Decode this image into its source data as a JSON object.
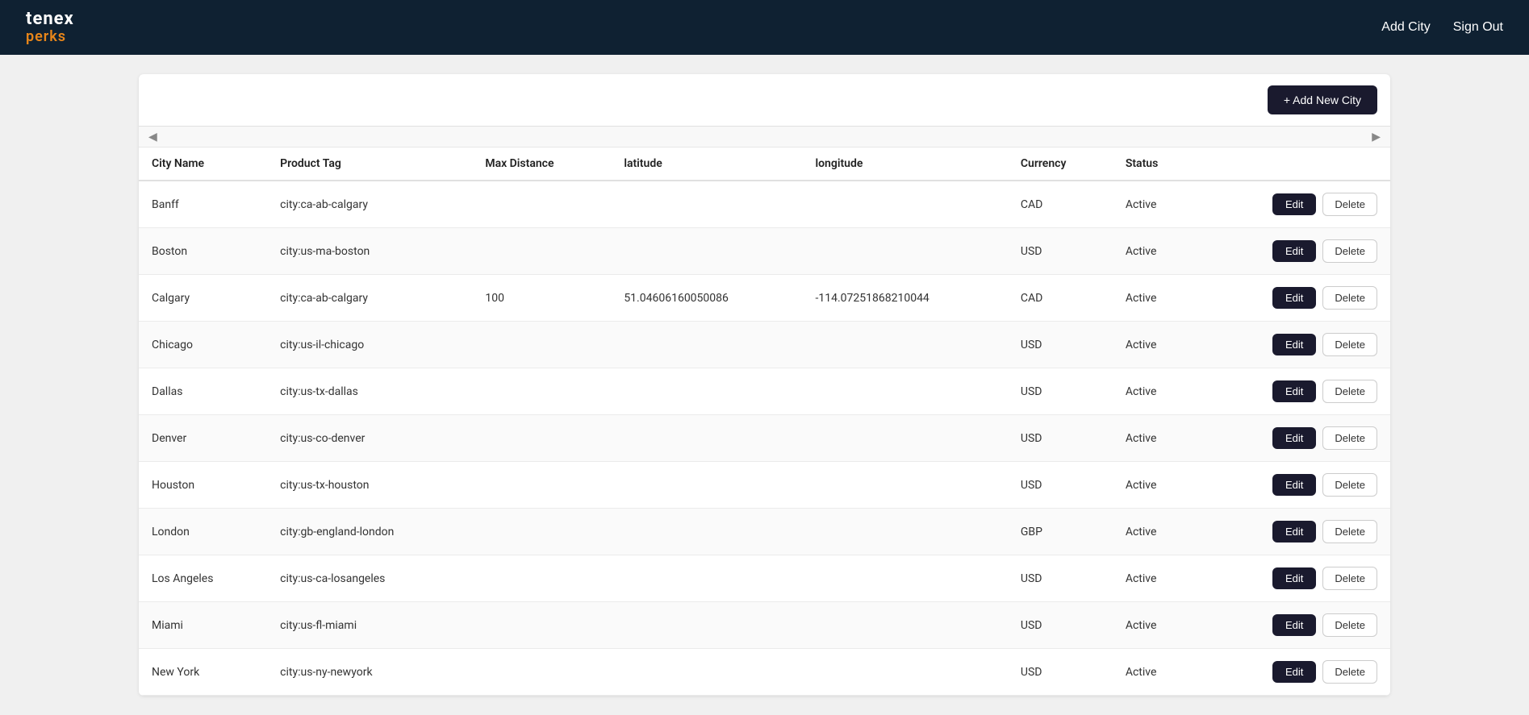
{
  "navbar": {
    "brand_tenex": "tenex",
    "brand_perks": "perks",
    "add_city_label": "Add City",
    "sign_out_label": "Sign Out"
  },
  "toolbar": {
    "add_new_label": "+ Add New City"
  },
  "scroll": {
    "left_arrow": "◀",
    "right_arrow": "▶"
  },
  "table": {
    "columns": [
      {
        "id": "city_name",
        "label": "City Name"
      },
      {
        "id": "product_tag",
        "label": "Product Tag"
      },
      {
        "id": "max_distance",
        "label": "Max Distance"
      },
      {
        "id": "latitude",
        "label": "latitude"
      },
      {
        "id": "longitude",
        "label": "longitude"
      },
      {
        "id": "currency",
        "label": "Currency"
      },
      {
        "id": "status",
        "label": "Status"
      },
      {
        "id": "actions",
        "label": ""
      }
    ],
    "rows": [
      {
        "city_name": "Banff",
        "product_tag": "city:ca-ab-calgary",
        "max_distance": "",
        "latitude": "",
        "longitude": "",
        "currency": "CAD",
        "status": "Active"
      },
      {
        "city_name": "Boston",
        "product_tag": "city:us-ma-boston",
        "max_distance": "",
        "latitude": "",
        "longitude": "",
        "currency": "USD",
        "status": "Active"
      },
      {
        "city_name": "Calgary",
        "product_tag": "city:ca-ab-calgary",
        "max_distance": "100",
        "latitude": "51.04606160050086",
        "longitude": "-114.07251868210044",
        "currency": "CAD",
        "status": "Active"
      },
      {
        "city_name": "Chicago",
        "product_tag": "city:us-il-chicago",
        "max_distance": "",
        "latitude": "",
        "longitude": "",
        "currency": "USD",
        "status": "Active"
      },
      {
        "city_name": "Dallas",
        "product_tag": "city:us-tx-dallas",
        "max_distance": "",
        "latitude": "",
        "longitude": "",
        "currency": "USD",
        "status": "Active"
      },
      {
        "city_name": "Denver",
        "product_tag": "city:us-co-denver",
        "max_distance": "",
        "latitude": "",
        "longitude": "",
        "currency": "USD",
        "status": "Active"
      },
      {
        "city_name": "Houston",
        "product_tag": "city:us-tx-houston",
        "max_distance": "",
        "latitude": "",
        "longitude": "",
        "currency": "USD",
        "status": "Active"
      },
      {
        "city_name": "London",
        "product_tag": "city:gb-england-london",
        "max_distance": "",
        "latitude": "",
        "longitude": "",
        "currency": "GBP",
        "status": "Active"
      },
      {
        "city_name": "Los Angeles",
        "product_tag": "city:us-ca-losangeles",
        "max_distance": "",
        "latitude": "",
        "longitude": "",
        "currency": "USD",
        "status": "Active"
      },
      {
        "city_name": "Miami",
        "product_tag": "city:us-fl-miami",
        "max_distance": "",
        "latitude": "",
        "longitude": "",
        "currency": "USD",
        "status": "Active"
      },
      {
        "city_name": "New York",
        "product_tag": "city:us-ny-newyork",
        "max_distance": "",
        "latitude": "",
        "longitude": "",
        "currency": "USD",
        "status": "Active"
      }
    ],
    "edit_label": "Edit",
    "delete_label": "Delete"
  }
}
